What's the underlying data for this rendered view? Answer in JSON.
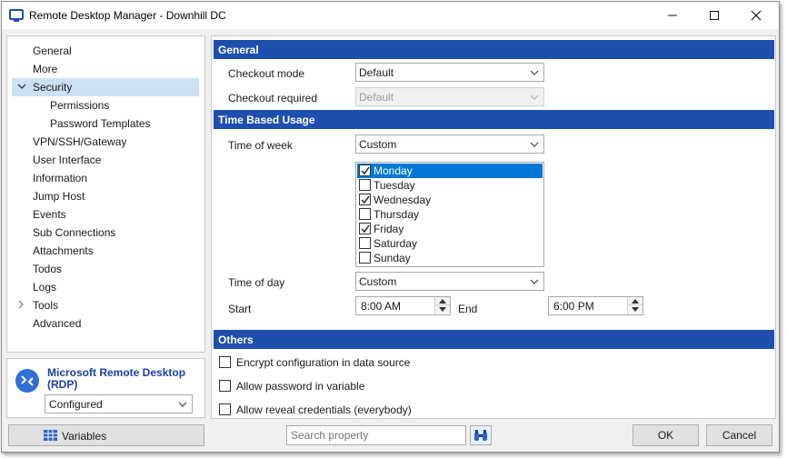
{
  "window": {
    "title": "Remote Desktop Manager - Downhill DC"
  },
  "sidebar": {
    "items": [
      {
        "label": "General",
        "level": 0,
        "expander": "",
        "selected": false
      },
      {
        "label": "More",
        "level": 0,
        "expander": "",
        "selected": false
      },
      {
        "label": "Security",
        "level": 0,
        "expander": "expanded",
        "selected": true
      },
      {
        "label": "Permissions",
        "level": 1,
        "expander": "",
        "selected": false
      },
      {
        "label": "Password Templates",
        "level": 1,
        "expander": "",
        "selected": false
      },
      {
        "label": "VPN/SSH/Gateway",
        "level": 0,
        "expander": "",
        "selected": false
      },
      {
        "label": "User Interface",
        "level": 0,
        "expander": "",
        "selected": false
      },
      {
        "label": "Information",
        "level": 0,
        "expander": "",
        "selected": false
      },
      {
        "label": "Jump Host",
        "level": 0,
        "expander": "",
        "selected": false
      },
      {
        "label": "Events",
        "level": 0,
        "expander": "",
        "selected": false
      },
      {
        "label": "Sub Connections",
        "level": 0,
        "expander": "",
        "selected": false
      },
      {
        "label": "Attachments",
        "level": 0,
        "expander": "",
        "selected": false
      },
      {
        "label": "Todos",
        "level": 0,
        "expander": "",
        "selected": false
      },
      {
        "label": "Logs",
        "level": 0,
        "expander": "",
        "selected": false
      },
      {
        "label": "Tools",
        "level": 0,
        "expander": "collapsed",
        "selected": false
      },
      {
        "label": "Advanced",
        "level": 0,
        "expander": "",
        "selected": false
      }
    ]
  },
  "entry": {
    "name": "Microsoft Remote Desktop (RDP)",
    "status": "Configured"
  },
  "variables_button": {
    "label": "Variables"
  },
  "sections": {
    "general": {
      "title": "General",
      "checkout_mode_label": "Checkout mode",
      "checkout_mode_value": "Default",
      "checkout_required_label": "Checkout required",
      "checkout_required_value": "Default"
    },
    "time_based": {
      "title": "Time Based Usage",
      "time_of_week_label": "Time of week",
      "time_of_week_value": "Custom",
      "days": [
        {
          "name": "Monday",
          "checked": true,
          "selected": true
        },
        {
          "name": "Tuesday",
          "checked": false,
          "selected": false
        },
        {
          "name": "Wednesday",
          "checked": true,
          "selected": false
        },
        {
          "name": "Thursday",
          "checked": false,
          "selected": false
        },
        {
          "name": "Friday",
          "checked": true,
          "selected": false
        },
        {
          "name": "Saturday",
          "checked": false,
          "selected": false
        },
        {
          "name": "Sunday",
          "checked": false,
          "selected": false
        }
      ],
      "time_of_day_label": "Time of day",
      "time_of_day_value": "Custom",
      "start_label": "Start",
      "start_value": "8:00 AM",
      "end_label": "End",
      "end_value": "6:00 PM"
    },
    "others": {
      "title": "Others",
      "options": [
        {
          "label": "Encrypt configuration in data source",
          "checked": false
        },
        {
          "label": "Allow password in variable",
          "checked": false
        },
        {
          "label": "Allow reveal credentials (everybody)",
          "checked": false
        }
      ]
    }
  },
  "footer": {
    "search_placeholder": "Search property",
    "ok_label": "OK",
    "cancel_label": "Cancel"
  },
  "colors": {
    "section_header": "#1f4fae",
    "selection": "#0078d7",
    "entry_name": "#1e3f9e"
  }
}
